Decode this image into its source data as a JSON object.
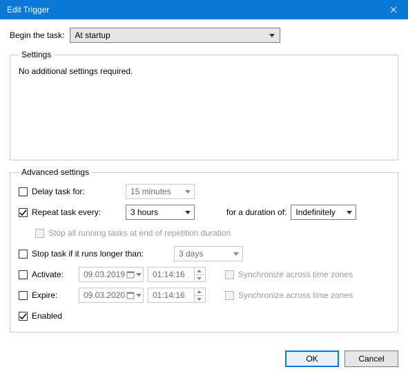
{
  "window": {
    "title": "Edit Trigger"
  },
  "begin": {
    "label": "Begin the task:",
    "value": "At startup"
  },
  "settings": {
    "legend": "Settings",
    "noAdditional": "No additional settings required."
  },
  "advanced": {
    "legend": "Advanced settings",
    "delay": {
      "label": "Delay task for:",
      "checked": false,
      "value": "15 minutes"
    },
    "repeat": {
      "label": "Repeat task every:",
      "checked": true,
      "value": "3 hours",
      "durationLabel": "for a duration of:",
      "duration": "Indefinitely"
    },
    "stopAtEnd": {
      "label": "Stop all running tasks at end of repetition duration",
      "checked": false
    },
    "stopIfLonger": {
      "label": "Stop task if it runs longer than:",
      "checked": false,
      "value": "3 days"
    },
    "activate": {
      "label": "Activate:",
      "checked": false,
      "date": "09.03.2019",
      "time": "01:14:16",
      "syncLabel": "Synchronize across time zones",
      "syncChecked": false
    },
    "expire": {
      "label": "Expire:",
      "checked": false,
      "date": "09.03.2020",
      "time": "01:14:16",
      "syncLabel": "Synchronize across time zones",
      "syncChecked": false
    },
    "enabled": {
      "label": "Enabled",
      "checked": true
    }
  },
  "buttons": {
    "ok": "OK",
    "cancel": "Cancel"
  }
}
